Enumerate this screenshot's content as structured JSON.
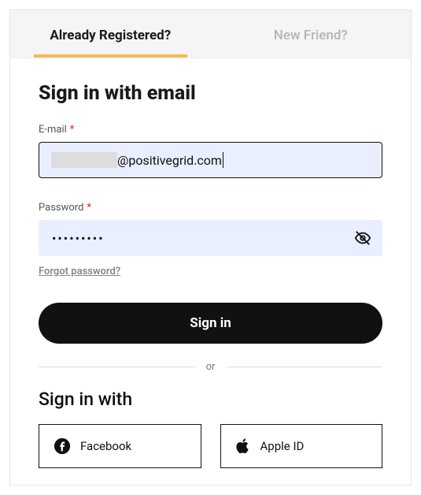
{
  "tabs": {
    "registered": "Already Registered?",
    "newfriend": "New Friend?"
  },
  "heading": "Sign in with email",
  "email": {
    "label": "E-mail",
    "value_suffix": "@positivegrid.com"
  },
  "password": {
    "label": "Password",
    "value": "•••••••••"
  },
  "forgot": "Forgot password?",
  "signin": "Sign in",
  "divider": "or",
  "social_heading": "Sign in with",
  "social": {
    "facebook": "Facebook",
    "apple": "Apple ID"
  }
}
